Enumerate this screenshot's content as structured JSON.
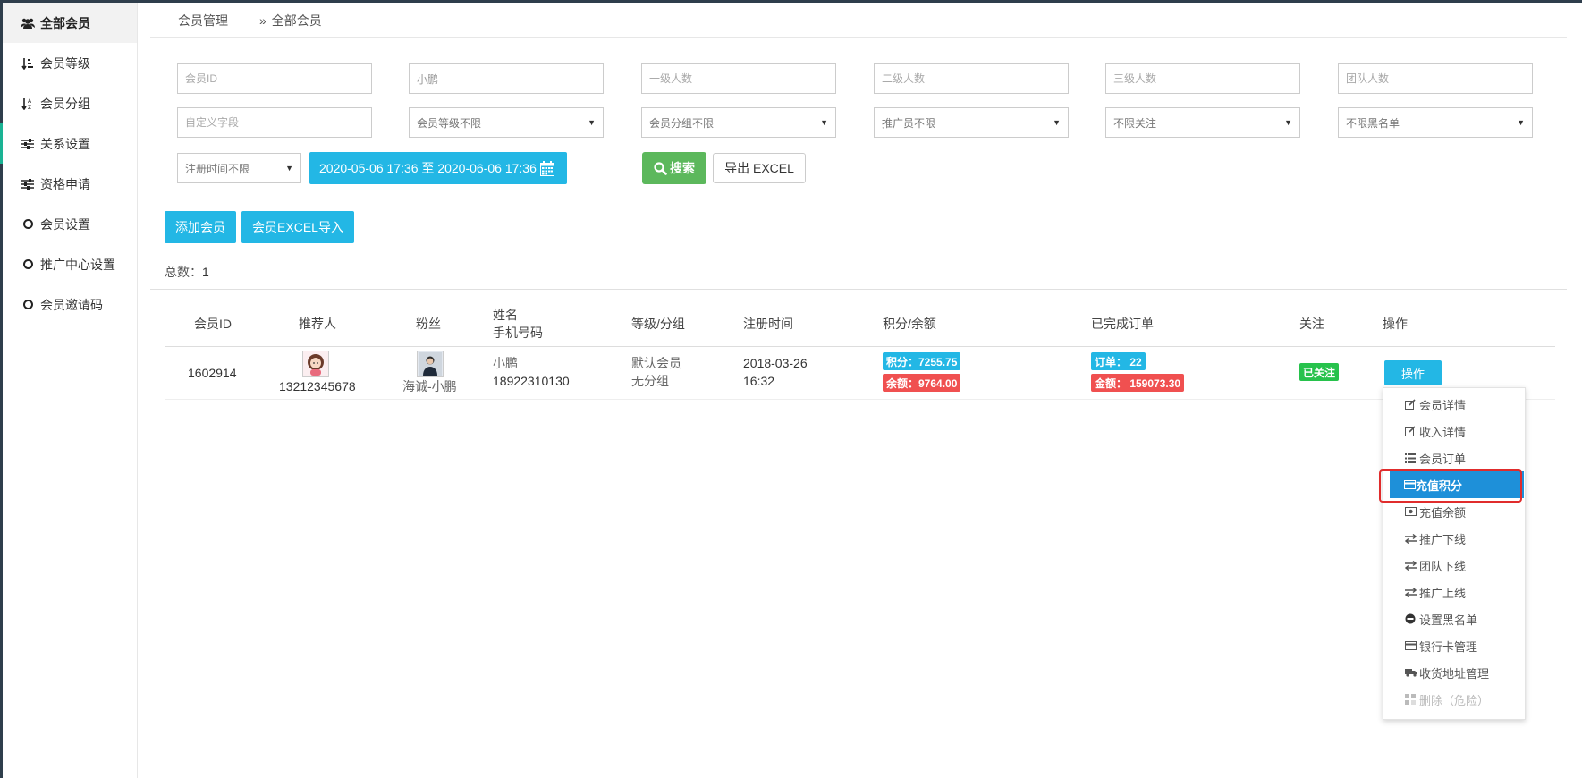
{
  "sidebar": {
    "items": [
      {
        "label": "全部会员",
        "icon": "users-icon"
      },
      {
        "label": "会员等级",
        "icon": "sort-amount-icon"
      },
      {
        "label": "会员分组",
        "icon": "sort-alpha-icon"
      },
      {
        "label": "关系设置",
        "icon": "sliders-icon"
      },
      {
        "label": "资格申请",
        "icon": "sliders-icon"
      },
      {
        "label": "会员设置",
        "icon": "circle-icon"
      },
      {
        "label": "推广中心设置",
        "icon": "circle-icon"
      },
      {
        "label": "会员邀请码",
        "icon": "circle-icon"
      }
    ]
  },
  "breadcrumb": {
    "root": "会员管理",
    "separator": "»",
    "current": "全部会员"
  },
  "filters": {
    "member_id_placeholder": "会员ID",
    "keyword_value": "小鹏",
    "level1_placeholder": "一级人数",
    "level2_placeholder": "二级人数",
    "level3_placeholder": "三级人数",
    "team_placeholder": "团队人数",
    "custom_field_placeholder": "自定义字段",
    "member_level": "会员等级不限",
    "member_group": "会员分组不限",
    "promoter": "推广员不限",
    "follow": "不限关注",
    "blacklist": "不限黑名单",
    "reg_time": "注册时间不限",
    "date_range": "2020-05-06 17:36 至 2020-06-06 17:36"
  },
  "actions": {
    "search": "搜索",
    "export": "导出 EXCEL",
    "add_member": "添加会员",
    "import_excel": "会员EXCEL导入"
  },
  "total": {
    "label": "总数：",
    "value": "1"
  },
  "table": {
    "headers": {
      "id": "会员ID",
      "referrer": "推荐人",
      "fan": "粉丝",
      "name": "姓名",
      "phone": "手机号码",
      "level_group": "等级/分组",
      "reg_time": "注册时间",
      "points_balance": "积分/余额",
      "orders": "已完成订单",
      "follow": "关注",
      "ops": "操作"
    },
    "row": {
      "id": "1602914",
      "referrer_phone": "13212345678",
      "fan_name": "海诚-小鹏",
      "name": "小鹏",
      "phone": "18922310130",
      "level": "默认会员",
      "group": "无分组",
      "reg_date": "2018-03-26",
      "reg_time": "16:32",
      "points": "积分：7255.75",
      "balance": "余额：9764.00",
      "orders": "订单：  22",
      "amount": "金额：  159073.30",
      "follow": "已关注",
      "ops": "操作"
    }
  },
  "menu": {
    "items": [
      {
        "label": "会员详情",
        "icon": "edit-icon"
      },
      {
        "label": "收入详情",
        "icon": "edit-icon"
      },
      {
        "label": "会员订单",
        "icon": "list-icon"
      },
      {
        "label": "充值积分",
        "icon": "credit-card-icon"
      },
      {
        "label": "充值余额",
        "icon": "money-icon"
      },
      {
        "label": "推广下线",
        "icon": "exchange-icon"
      },
      {
        "label": "团队下线",
        "icon": "exchange-icon"
      },
      {
        "label": "推广上线",
        "icon": "exchange-icon"
      },
      {
        "label": "设置黑名单",
        "icon": "minus-circle-icon"
      },
      {
        "label": "银行卡管理",
        "icon": "credit-card-icon"
      },
      {
        "label": "收货地址管理",
        "icon": "truck-icon"
      },
      {
        "label": "删除（危险）",
        "icon": "delete-icon"
      }
    ]
  },
  "colors": {
    "primary": "#23b7e5",
    "success": "#5cb85c",
    "danger": "#f05050",
    "follow_badge": "#27c24c",
    "menu_active": "#1e90d9",
    "highlight_border": "#e02c2c"
  }
}
